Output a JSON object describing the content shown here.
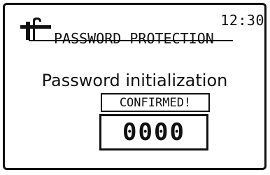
{
  "header": {
    "time": "12:30",
    "title": "PASSWORD PROTECTION",
    "icon": "tools-icon"
  },
  "main": {
    "subtitle": "Password initialization",
    "status": "CONFIRMED!",
    "code": "0000"
  }
}
